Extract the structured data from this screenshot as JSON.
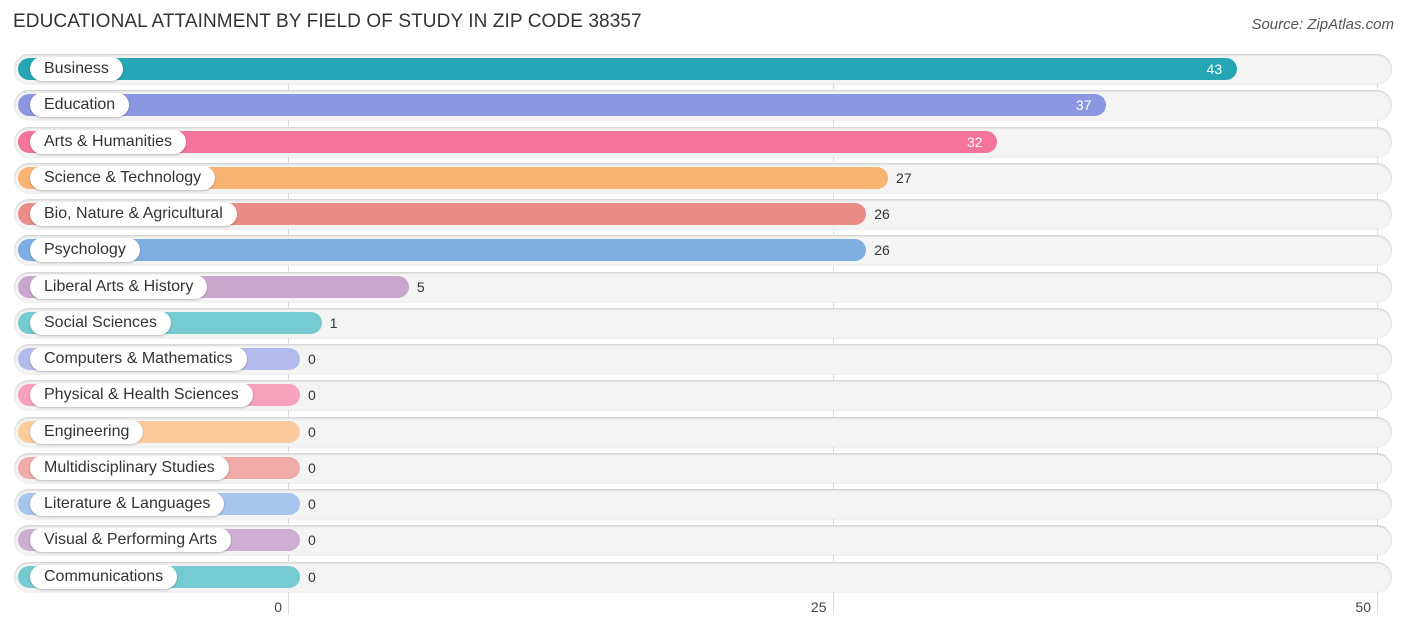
{
  "header": {
    "title": "EDUCATIONAL ATTAINMENT BY FIELD OF STUDY IN ZIP CODE 38357",
    "source": "Source: ZipAtlas.com"
  },
  "chart_data": {
    "type": "bar",
    "orientation": "horizontal",
    "title": "EDUCATIONAL ATTAINMENT BY FIELD OF STUDY IN ZIP CODE 38357",
    "xlabel": "",
    "ylabel": "",
    "xlim": [
      0,
      50
    ],
    "xticks": [
      "0",
      "25",
      "50"
    ],
    "grid": true,
    "categories": [
      "Business",
      "Education",
      "Arts & Humanities",
      "Science & Technology",
      "Bio, Nature & Agricultural",
      "Psychology",
      "Liberal Arts & History",
      "Social Sciences",
      "Computers & Mathematics",
      "Physical & Health Sciences",
      "Engineering",
      "Multidisciplinary Studies",
      "Literature & Languages",
      "Visual & Performing Arts",
      "Communications"
    ],
    "values": [
      43,
      37,
      32,
      27,
      26,
      26,
      5,
      1,
      0,
      0,
      0,
      0,
      0,
      0,
      0
    ],
    "colors": [
      "#26a6b5",
      "#8b97e0",
      "#f4749c",
      "#f9b373",
      "#eb8c87",
      "#7eaee2",
      "#c9a7cc",
      "#75cbcf",
      "#b3bbec",
      "#f7a2bd",
      "#fbcb9c",
      "#f0aaa8",
      "#a7c6ec",
      "#cfaed3",
      "#76cad2"
    ]
  }
}
